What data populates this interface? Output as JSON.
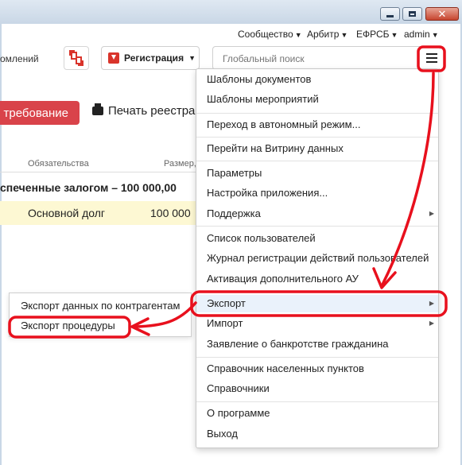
{
  "window": {
    "buttons": [
      "minimize",
      "maximize",
      "close"
    ]
  },
  "top_links": [
    {
      "label": "Сообщество"
    },
    {
      "label": "Арбитр"
    },
    {
      "label": "ЕФРСБ"
    },
    {
      "label": "admin"
    }
  ],
  "header": {
    "notifications_partial": "омлений",
    "registration_label": "Регистрация",
    "search_placeholder": "Глобальный поиск"
  },
  "actions": {
    "demand_label": "требование",
    "print_label": "Печать реестра"
  },
  "table": {
    "headers": [
      "Обязательства",
      "Размер,"
    ],
    "group_title": "спеченные залогом – 100 000,00",
    "rows": [
      {
        "obligation": "Основной долг",
        "amount": "100 000"
      }
    ]
  },
  "menu": {
    "items": [
      {
        "label": "Шаблоны документов"
      },
      {
        "label": "Шаблоны мероприятий"
      },
      {
        "label": "Переход в автономный режим..."
      },
      {
        "label": "Перейти на Витрину данных"
      },
      {
        "label": "Параметры"
      },
      {
        "label": "Настройка приложения..."
      },
      {
        "label": "Поддержка",
        "has_submenu": true
      },
      {
        "label": "Список пользователей"
      },
      {
        "label": "Журнал регистрации действий пользователей"
      },
      {
        "label": "Активация дополнительного АУ"
      },
      {
        "label": "Экспорт",
        "has_submenu": true
      },
      {
        "label": "Импорт",
        "has_submenu": true
      },
      {
        "label": "Заявление о банкротстве гражданина"
      },
      {
        "label": "Справочник населенных пунктов"
      },
      {
        "label": "Справочники"
      },
      {
        "label": "О программе"
      },
      {
        "label": "Выход"
      }
    ]
  },
  "submenu": {
    "items": [
      {
        "label": "Экспорт данных по контрагентам"
      },
      {
        "label": "Экспорт процедуры"
      }
    ]
  },
  "colors": {
    "accent_red": "#d9434a",
    "annotation_red": "#e8101d",
    "highlight_row": "#fdf8d3"
  }
}
